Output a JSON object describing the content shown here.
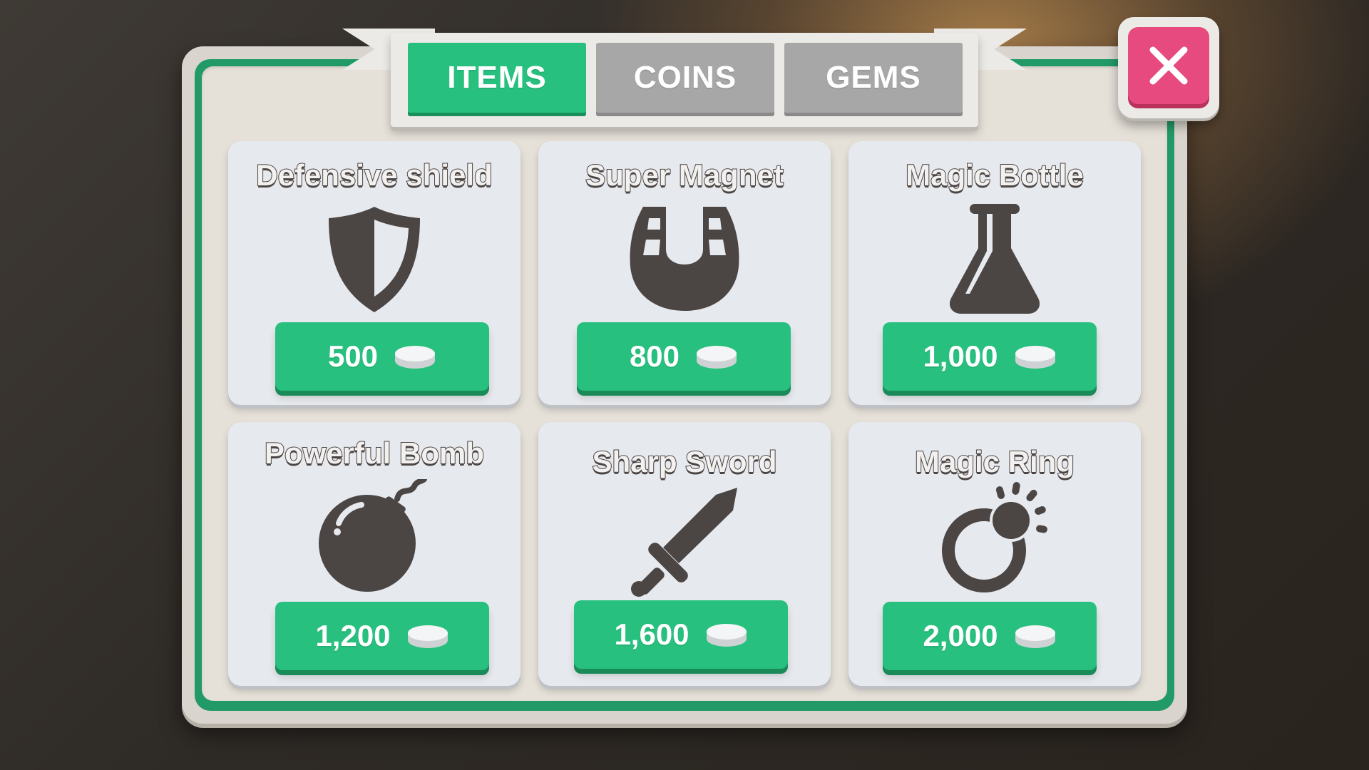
{
  "shop": {
    "tabs": [
      {
        "label": "ITEMS",
        "active": true
      },
      {
        "label": "COINS",
        "active": false
      },
      {
        "label": "GEMS",
        "active": false
      }
    ],
    "close_icon": "close-icon",
    "items": [
      {
        "name": "Defensive shield",
        "price": "500",
        "icon": "shield-icon"
      },
      {
        "name": "Super Magnet",
        "price": "800",
        "icon": "magnet-icon"
      },
      {
        "name": "Magic Bottle",
        "price": "1,000",
        "icon": "flask-icon"
      },
      {
        "name": "Powerful Bomb",
        "price": "1,200",
        "icon": "bomb-icon"
      },
      {
        "name": "Sharp Sword",
        "price": "1,600",
        "icon": "sword-icon"
      },
      {
        "name": "Magic Ring",
        "price": "2,000",
        "icon": "ring-icon"
      }
    ],
    "currency_icon": "coin-stack-icon"
  },
  "colors": {
    "accent_green": "#27c07e",
    "inactive_gray": "#a7a7a7",
    "close_pink": "#e64a7e",
    "icon_dark": "#4b4544"
  }
}
